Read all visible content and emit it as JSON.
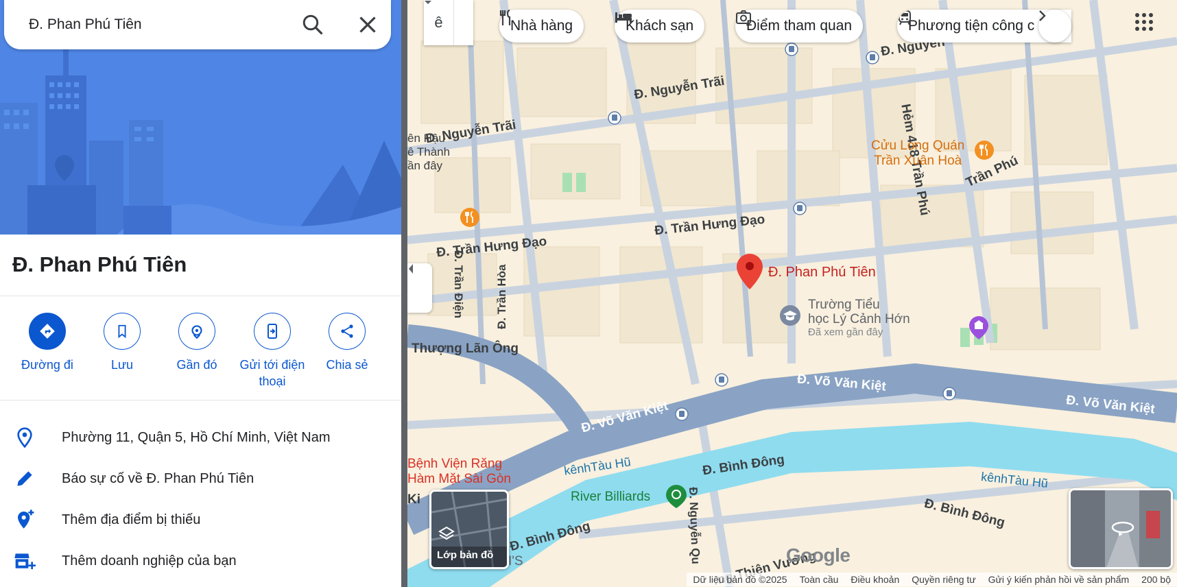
{
  "search": {
    "value": "Đ. Phan Phú Tiên",
    "search_icon": "search-icon",
    "close_icon": "close-icon"
  },
  "place": {
    "title": "Đ. Phan Phú Tiên"
  },
  "actions": [
    {
      "label": "Đường đi",
      "icon": "directions-icon"
    },
    {
      "label": "Lưu",
      "icon": "bookmark-icon"
    },
    {
      "label": "Gần đó",
      "icon": "nearby-icon"
    },
    {
      "label": "Gửi tới điện thoại",
      "icon": "send-to-phone-icon"
    },
    {
      "label": "Chia sẻ",
      "icon": "share-icon"
    }
  ],
  "info": [
    {
      "text": "Phường 11, Quận 5, Hồ Chí Minh, Việt Nam",
      "icon": "location-pin-icon"
    },
    {
      "text": "Báo sự cố về Đ. Phan Phú Tiên",
      "icon": "pencil-icon"
    },
    {
      "text": "Thêm địa điểm bị thiếu",
      "icon": "add-location-icon"
    },
    {
      "text": "Thêm doanh nghiệp của bạn",
      "icon": "add-business-icon"
    }
  ],
  "map": {
    "input_tool_label": "ê",
    "categories": [
      {
        "label": "Nhà hàng",
        "icon": "restaurant-icon"
      },
      {
        "label": "Khách sạn",
        "icon": "hotel-icon"
      },
      {
        "label": "Điểm tham quan",
        "icon": "camera-icon"
      },
      {
        "label": "Phương tiện công c",
        "icon": "transit-icon"
      }
    ],
    "labels": {
      "nguyen_trai_1": "Đ. Nguyễn Trãi",
      "nguyen_trai_2": "Đ. Nguyễn Trãi",
      "nguyen_top": "Đ. Nguyễn",
      "hem418": "Hẻm 418 Trần Phú",
      "tran_phu": "Trần Phú",
      "tran_hung_dao_1": "Đ. Trần Hưng Đạo",
      "tran_hung_dao_2": "Đ. Trần Hưng Đạo",
      "tran_dien": "Đ. Trần Điện",
      "tran_hoa": "Đ. Trần Hòa",
      "thuong_lan_ong": "Thượng Lãn Ông",
      "vo_van_kiet_1": "Đ. Võ Văn Kiệt",
      "vo_van_kiet_2": "Đ. Võ Văn Kiệt",
      "vo_van_kiet_3": "Đ. Võ Văn Kiệt",
      "binh_dong_1": "Đ. Bình Đông",
      "binh_dong_2": "Đ. Bình Đông",
      "binh_dong_3": "Đ. Bình Đông",
      "kenh_1": "kênhTàu Hũ",
      "kenh_2": "kênhTàu Hũ",
      "nguyen_qu": "Đ. Nguyễn Qu",
      "thien_vuong": "ng Thiện Vương",
      "hau_thanh": "ên Hậu -\nê Thành\nần đây",
      "cuu_long": "Cửu Long Quán\nTrần Xuân Hoà",
      "selected_pin": "Đ. Phan Phú Tiên",
      "school": "Trường Tiểu\nhọc Lý Cảnh Hớn",
      "school_sub": "Đã xem gần đây",
      "benh_vien": "Bệnh Viện Răng\nHàm Mặt Sài Gòn",
      "river_billiards": "River Billiards",
      "cati": "ee CATI'S",
      "ki": "Ki"
    },
    "layer_label": "Lớp bản đồ",
    "logo": "Google",
    "footer": [
      "Dữ liệu bản đồ ©2025",
      "Toàn cầu",
      "Điều khoản",
      "Quyền riêng tư",
      "Gửi ý kiến phản hồi về sản phẩm",
      "200 bộ"
    ]
  }
}
